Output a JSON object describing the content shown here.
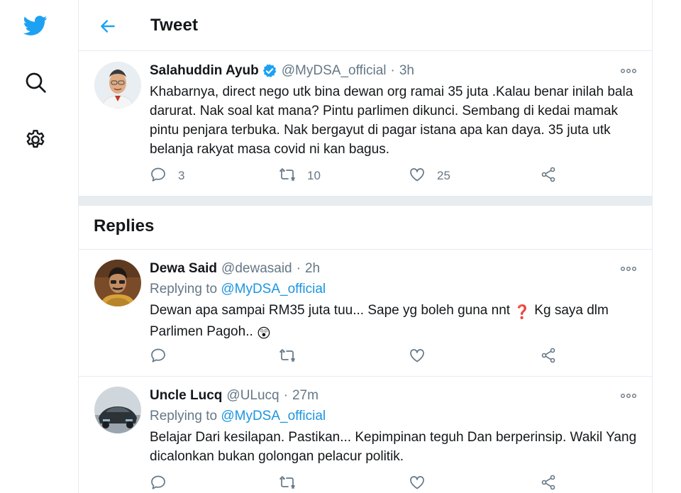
{
  "header": {
    "title": "Tweet"
  },
  "nav": {
    "icons": [
      "twitter-logo-icon",
      "search-icon",
      "settings-gear-icon",
      "back-arrow-icon"
    ]
  },
  "main_tweet": {
    "name": "Salahuddin Ayub",
    "handle": "@MyDSA_official",
    "dot": "·",
    "time": "3h",
    "text": "Khabarnya, direct nego utk bina dewan org ramai 35 juta .Kalau benar inilah bala darurat. Nak soal kat mana? Pintu  parlimen dikunci. Sembang di kedai mamak pintu penjara terbuka. Nak bergayut di pagar istana apa kan daya. 35 juta utk belanja rakyat masa covid ni kan bagus.",
    "replies": "3",
    "retweets": "10",
    "likes": "25"
  },
  "replies_section": {
    "title": "Replies"
  },
  "replies": [
    {
      "name": "Dewa Said",
      "handle": "@dewasaid",
      "dot": "·",
      "time": "2h",
      "replying_prefix": "Replying to",
      "replying_handle": "@MyDSA_official",
      "text_part1": "Dewan apa sampai RM35 juta tuu... Sape yg boleh guna nnt",
      "emoji1": "❓",
      "text_part2": "Kg saya dlm Parlimen Pagoh..",
      "emoji2": "😲"
    },
    {
      "name": "Uncle Lucq",
      "handle": "@ULucq",
      "dot": "·",
      "time": "27m",
      "replying_prefix": "Replying to",
      "replying_handle": "@MyDSA_official",
      "text": "Belajar Dari kesilapan. Pastikan... Kepimpinan teguh Dan berperinsip. Wakil Yang dicalonkan bukan golongan pelacur politik."
    }
  ],
  "colors": {
    "accent": "#1da1f2",
    "link": "#1b95e0",
    "secondary_text": "#657786",
    "border": "#e6ecf0"
  }
}
